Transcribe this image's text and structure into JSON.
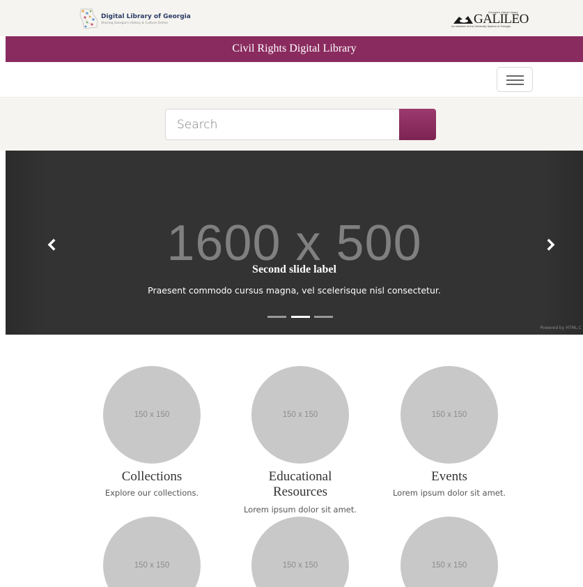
{
  "partners": {
    "dlg_title": "Digital Library of Georgia",
    "dlg_tagline": "Sharing Georgia's History & Culture Online",
    "galileo_top": "Georgia's Virtual Library",
    "galileo_name": "GALILEO",
    "galileo_sub": "An Initiative of the University System of Georgia"
  },
  "header": {
    "site_title": "Civil Rights Digital Library"
  },
  "search": {
    "placeholder": "Search"
  },
  "carousel": {
    "image_placeholder": "1600 x 500",
    "slide_label": "Second slide label",
    "slide_text": "Praesent commodo cursus magna, vel scelerisque nisl consectetur.",
    "active_index": 1,
    "slide_count": 3,
    "powered_by": "Powered by HTML.C"
  },
  "tiles": [
    {
      "image": "150 x 150",
      "title": "Collections",
      "desc": "Explore our collections."
    },
    {
      "image": "150 x 150",
      "title": "Educational Resources",
      "desc": "Lorem ipsum dolor sit amet."
    },
    {
      "image": "150 x 150",
      "title": "Events",
      "desc": "Lorem ipsum dolor sit amet."
    },
    {
      "image": "150 x 150"
    },
    {
      "image": "150 x 150"
    },
    {
      "image": "150 x 150"
    }
  ],
  "colors": {
    "brand": "#8a2b5f",
    "band": "#f6f4f0",
    "carousel_bg": "#333333",
    "placeholder_circle": "#c8c8c8"
  }
}
